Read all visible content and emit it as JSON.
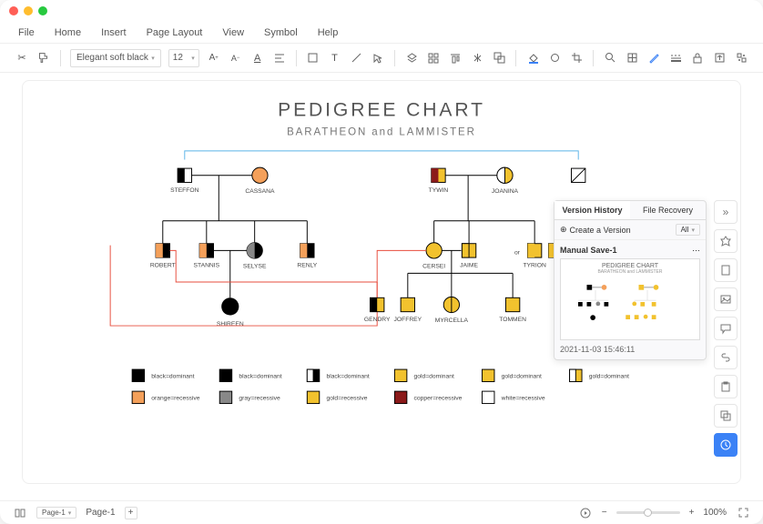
{
  "menu": {
    "file": "File",
    "home": "Home",
    "insert": "Insert",
    "pageLayout": "Page Layout",
    "view": "View",
    "symbol": "Symbol",
    "help": "Help"
  },
  "toolbar": {
    "font": "Elegant soft black",
    "size": "12"
  },
  "chart": {
    "title": "PEDIGREE  CHART",
    "subtitle": "BARATHEON  and  LAMMISTER",
    "people": {
      "steffon": "STEFFON",
      "cassana": "CASSANA",
      "tywin": "TYWIN",
      "joanina": "JOANINA",
      "robert": "ROBERT",
      "stannis": "STANNIS",
      "selyse": "SELYSE",
      "renly": "RENLY",
      "cersei": "CERSEI",
      "jaime": "JAIME",
      "tyrion": "TYRION",
      "shireen": "SHIREEN",
      "gendry": "GENDRY",
      "joffrey": "JOFFREY",
      "myrcella": "MYRCELLA",
      "tommen": "TOMMEN",
      "or": "or"
    },
    "legend": {
      "l1": "black=dominant",
      "l2": "black=dominant",
      "l3": "black=dominant",
      "l4": "gold=dominant",
      "l5": "gold=dominant",
      "l6": "gold=dominant",
      "l7": "orange=recessive",
      "l8": "gray=recessive",
      "l9": "gold=recessive",
      "l10": "copper=recessive",
      "l11": "white=recessive"
    }
  },
  "panel": {
    "tab1": "Version History",
    "tab2": "File Recovery",
    "create": "Create a Version",
    "filter": "All",
    "saveName": "Manual Save-1",
    "thumbTitle": "PEDIGREE  CHART",
    "thumbSubtitle": "BARATHEON  and  LAMMISTER",
    "timestamp": "2021-11-03 15:46:11"
  },
  "status": {
    "pageSel": "Page-1",
    "pageTab": "Page-1",
    "zoom": "100%",
    "plus": "+",
    "minus": "−"
  }
}
